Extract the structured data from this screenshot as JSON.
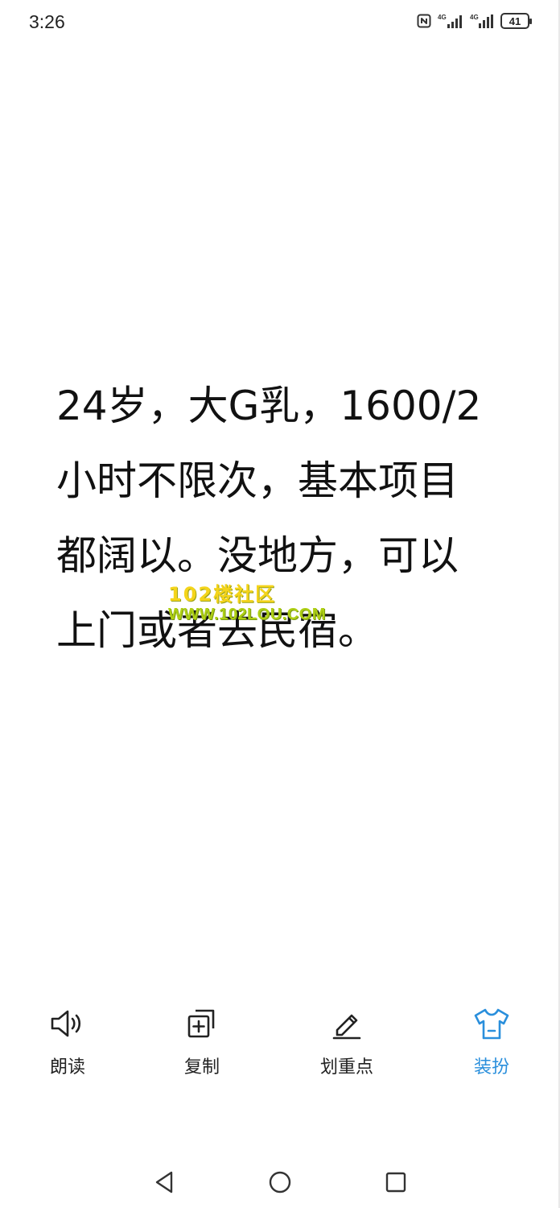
{
  "status_bar": {
    "time": "3:26",
    "icons": [
      "nfc-icon",
      "signal-4g-icon",
      "signal-4g-icon-2"
    ],
    "battery": "41",
    "signal_label_1": "4G",
    "signal_label_2": "4G"
  },
  "content": {
    "lines": [
      "24岁，大G乳，1600/2",
      "小时不限次，基本项目",
      "都阔以。没地方，可以",
      "上门或者去民宿。"
    ]
  },
  "watermark": {
    "line1": "102楼社区",
    "line2": "WWW.102LOU.COM"
  },
  "toolbar": {
    "items": [
      {
        "label": "朗读",
        "icon": "speaker-icon"
      },
      {
        "label": "复制",
        "icon": "copy-icon"
      },
      {
        "label": "划重点",
        "icon": "pencil-icon"
      },
      {
        "label": "装扮",
        "icon": "shirt-icon"
      }
    ],
    "active_color": "#2a8fdc"
  },
  "navbar": {
    "icons": [
      "back-triangle-icon",
      "home-circle-icon",
      "recents-square-icon"
    ]
  }
}
